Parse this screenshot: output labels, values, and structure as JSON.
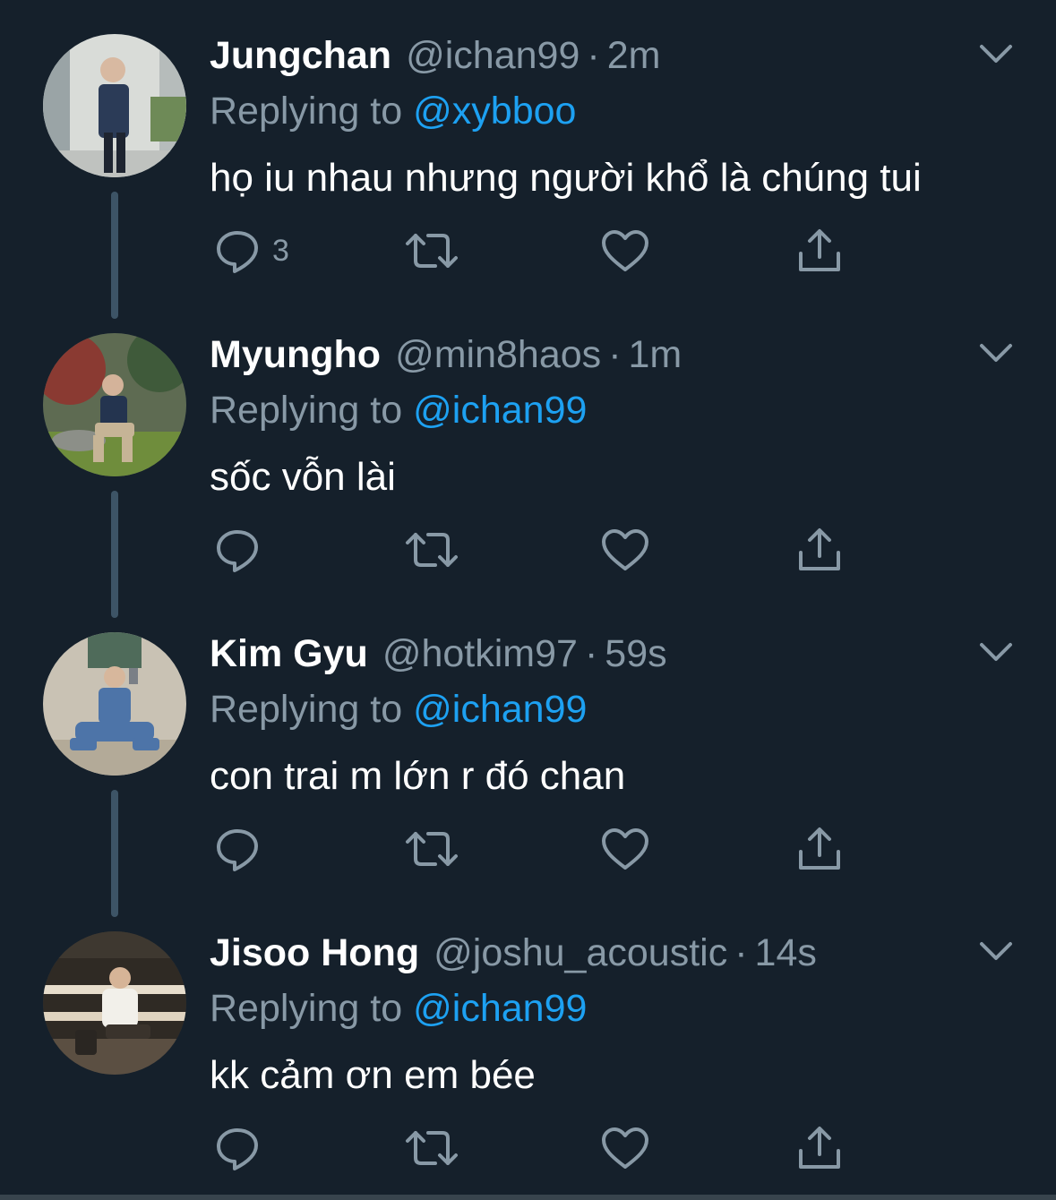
{
  "colors": {
    "background": "#15202b",
    "primary_text": "#ffffff",
    "secondary_text": "#8899a6",
    "accent": "#1da1f2",
    "thread_line": "#3d5466"
  },
  "icons": {
    "more": "chevron-down-icon",
    "reply": "reply-bubble-icon",
    "retweet": "retweet-icon",
    "like": "heart-icon",
    "share": "share-icon"
  },
  "tweets": [
    {
      "name": "Jungchan",
      "handle": "@ichan99",
      "dot": "·",
      "time": "2m",
      "reply_prefix": "Replying to",
      "reply_to": "@xybboo",
      "text": "họ iu nhau nhưng người khổ là chúng tui",
      "reply_count": "3"
    },
    {
      "name": "Myungho",
      "handle": "@min8haos",
      "dot": "·",
      "time": "1m",
      "reply_prefix": "Replying to",
      "reply_to": "@ichan99",
      "text": "sốc vỗn lài",
      "reply_count": ""
    },
    {
      "name": "Kim Gyu",
      "handle": "@hotkim97",
      "dot": "·",
      "time": "59s",
      "reply_prefix": "Replying to",
      "reply_to": "@ichan99",
      "text": "con trai m lớn r đó chan",
      "reply_count": ""
    },
    {
      "name": "Jisoo Hong",
      "handle": "@joshu_acoustic",
      "dot": "·",
      "time": "14s",
      "reply_prefix": "Replying to",
      "reply_to": "@ichan99",
      "text": "kk cảm ơn em bée",
      "reply_count": ""
    }
  ]
}
